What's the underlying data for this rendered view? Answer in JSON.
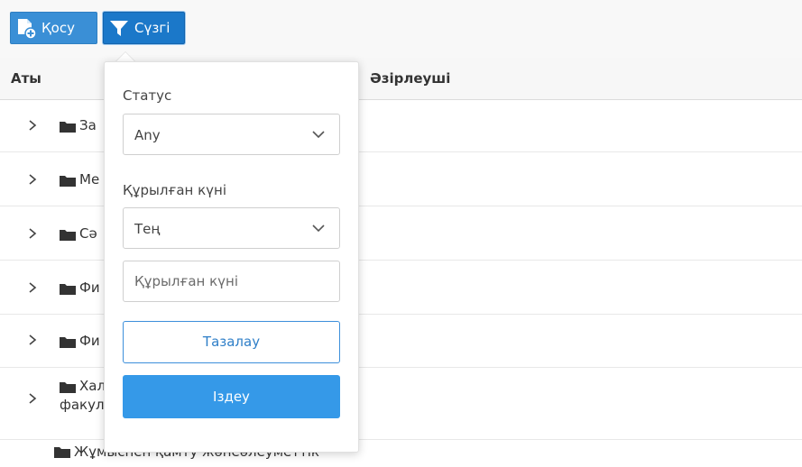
{
  "toolbar": {
    "add_label": "Қосу",
    "filter_label": "Сүзгі",
    "add_icon": "add-file-icon",
    "filter_icon": "funnel-icon"
  },
  "table": {
    "columns": [
      "Аты",
      "Әзірлеуші"
    ],
    "rows": [
      {
        "name": "За"
      },
      {
        "name": "Ме"
      },
      {
        "name": "Сә"
      },
      {
        "name": "Фи"
      },
      {
        "name": "Фи"
      },
      {
        "name": "Хал",
        "name_line2": "факул"
      },
      {
        "name": "Жұмыспен қамту жәнеәлеуметтік"
      }
    ]
  },
  "filter": {
    "status_label": "Статус",
    "status_value": "Any",
    "created_label": "Құрылған күні",
    "created_op_value": "Тең",
    "created_placeholder": "Құрылған күні",
    "clear_label": "Тазалау",
    "search_label": "Іздеу"
  },
  "colors": {
    "accent": "#3a8fd6",
    "search_button": "#3599e8",
    "header_bg": "#f7f7f7"
  }
}
